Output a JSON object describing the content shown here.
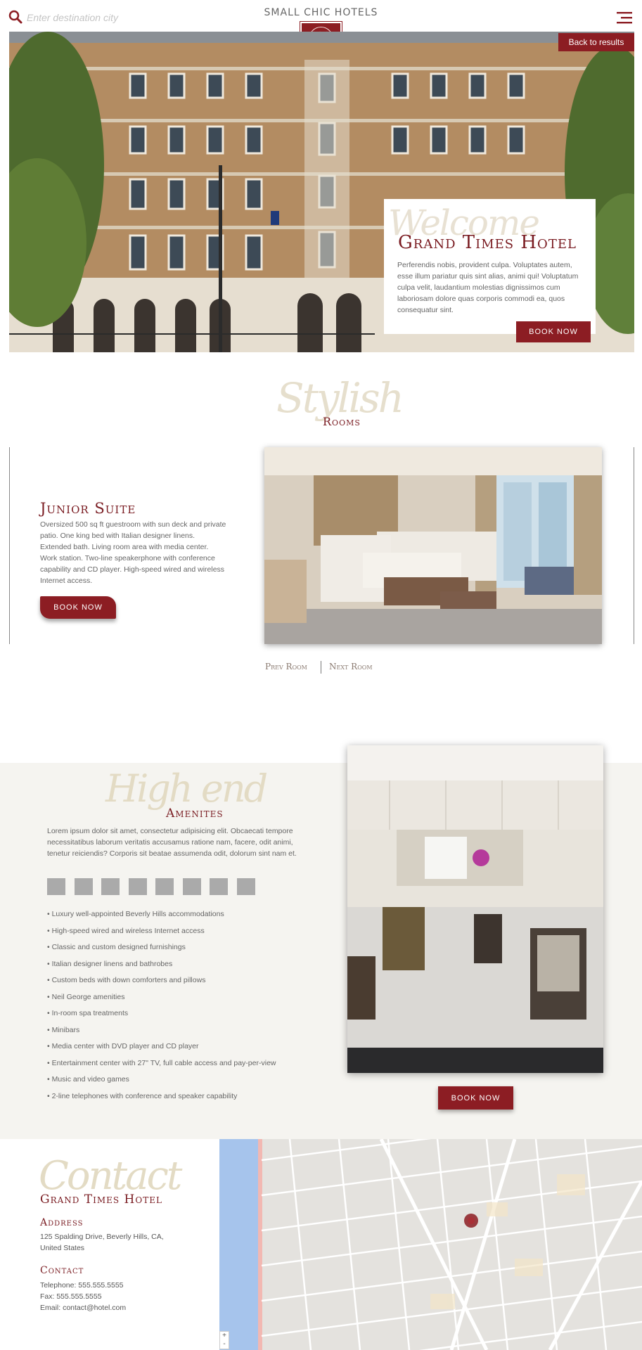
{
  "header": {
    "search_placeholder": "Enter destination city",
    "brand": "SMALL CHIC HOTELS",
    "logo_letters": "SH"
  },
  "hero": {
    "back_label": "Back to results",
    "welcome_script": "Welcome",
    "hotel_name": "Grand Times Hotel",
    "description": "Perferendis nobis, provident culpa. Voluptates autem, esse illum pariatur quis sint alias, animi qui! Voluptatum culpa velit, laudantium molestias dignissimos cum laboriosam dolore quas corporis commodi ea, quos consequatur sint.",
    "book_label": "BOOK NOW"
  },
  "rooms": {
    "script": "Stylish",
    "label": "Rooms",
    "room_title": "Junior Suite",
    "room_desc": "Oversized 500 sq ft guestroom with sun deck and private patio. One king bed with Italian designer linens. Extended bath. Living room area with media center. Work station. Two-line speakerphone with conference capability and CD player. High-speed wired and wireless Internet access.",
    "book_label": "BOOK NOW",
    "prev_label": "Prev Room",
    "next_label": "Next Room"
  },
  "amenities": {
    "script": "High end",
    "label": "Amenites",
    "description": "Lorem ipsum dolor sit amet, consectetur adipisicing elit. Obcaecati tempore necessitatibus laborum veritatis accusamus ratione nam, facere, odit animi, tenetur reiciendis? Corporis sit beatae assumenda odit, dolorum sint nam et.",
    "items": [
      "Luxury well-appointed Beverly Hills accommodations",
      "High-speed wired and wireless Internet access",
      "Classic and custom designed furnishings",
      "Italian designer linens and bathrobes",
      "Custom beds with down comforters and pillows",
      "Neil George amenities",
      "In-room spa treatments",
      "Minibars",
      "Media center with DVD player and CD player",
      "Entertainment center with 27\" TV, full cable access and pay-per-view",
      "Music and video games",
      "2-line telephones with conference and speaker capability"
    ],
    "book_label": "BOOK NOW"
  },
  "contact": {
    "script": "Contact",
    "hotel_name": "Grand Times Hotel",
    "address_heading": "Address",
    "address_line1": "125 Spalding Drive, Beverly Hills, CA,",
    "address_line2": "United States",
    "contact_heading": "Contact",
    "telephone": "Telephone: 555.555.5555",
    "fax": "Fax: 555.555.5555",
    "email": "Email: contact@hotel.com"
  },
  "map": {
    "zoom_in": "+",
    "zoom_out": "-"
  },
  "colors": {
    "accent": "#8c1d23",
    "script": "#e6dfcd",
    "amenities_bg": "#f5f4f0"
  }
}
